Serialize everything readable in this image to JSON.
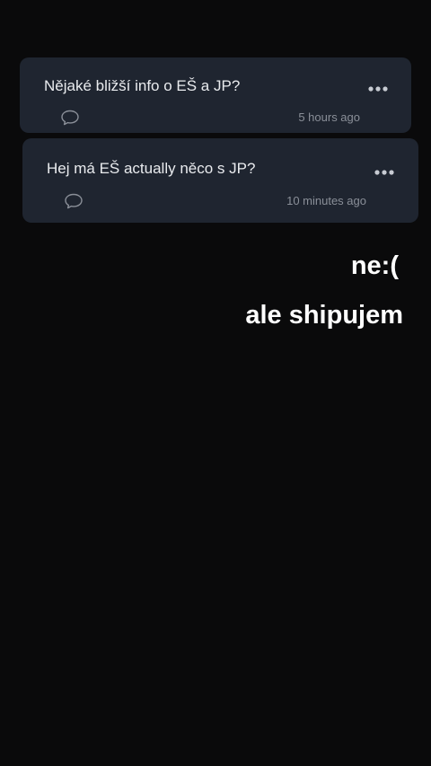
{
  "posts": [
    {
      "question": "Nějaké bližší info o EŠ a JP?",
      "timestamp": "5 hours ago",
      "icons": {
        "comment": "comment-icon",
        "more": "more-options-icon"
      }
    },
    {
      "question": "Hej má EŠ actually něco s JP?",
      "timestamp": "10 minutes ago",
      "icons": {
        "comment": "comment-icon",
        "more": "more-options-icon"
      }
    }
  ],
  "story_text": {
    "line1": "ne:(",
    "line2": "ale shipujem"
  },
  "colors": {
    "background": "#0a0a0b",
    "card": "#1f2530",
    "question_text": "#e9ebee",
    "muted": "#8a8f98",
    "overlay_text": "#ffffff"
  }
}
